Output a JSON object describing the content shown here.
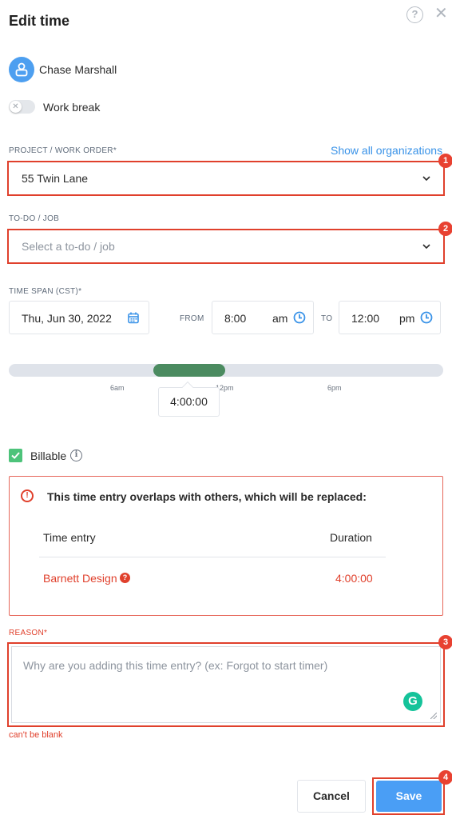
{
  "header": {
    "title": "Edit time"
  },
  "user": {
    "name": "Chase Marshall"
  },
  "work_break": {
    "label": "Work break",
    "enabled": false
  },
  "project": {
    "label": "PROJECT / WORK ORDER*",
    "link": "Show all organizations",
    "value": "55 Twin Lane",
    "badge": "1"
  },
  "todo": {
    "label": "TO-DO / JOB",
    "placeholder": "Select a to-do / job",
    "badge": "2"
  },
  "time_span": {
    "label": "TIME SPAN (CST)*",
    "date": "Thu, Jun 30, 2022",
    "from_label": "FROM",
    "from_time": "8:00",
    "from_ampm": "am",
    "to_label": "TO",
    "to_time": "12:00",
    "to_ampm": "pm"
  },
  "timeline": {
    "ticks": [
      "6am",
      "12pm",
      "6pm"
    ],
    "duration": "4:00:00",
    "range_color": "#4b8b60"
  },
  "billable": {
    "label": "Billable",
    "checked": true
  },
  "overlap": {
    "message": "This time entry overlaps with others, which will be replaced:",
    "col_entry": "Time entry",
    "col_duration": "Duration",
    "rows": [
      {
        "entry": "Barnett Design",
        "duration": "4:00:00"
      }
    ]
  },
  "reason": {
    "label": "REASON*",
    "placeholder": "Why are you adding this time entry? (ex: Forgot to start timer)",
    "error": "can't be blank",
    "badge": "3"
  },
  "footer": {
    "cancel": "Cancel",
    "save": "Save",
    "save_badge": "4"
  },
  "colors": {
    "accent": "#4a9ef5",
    "error": "#e0402c",
    "success": "#4dc37a"
  }
}
